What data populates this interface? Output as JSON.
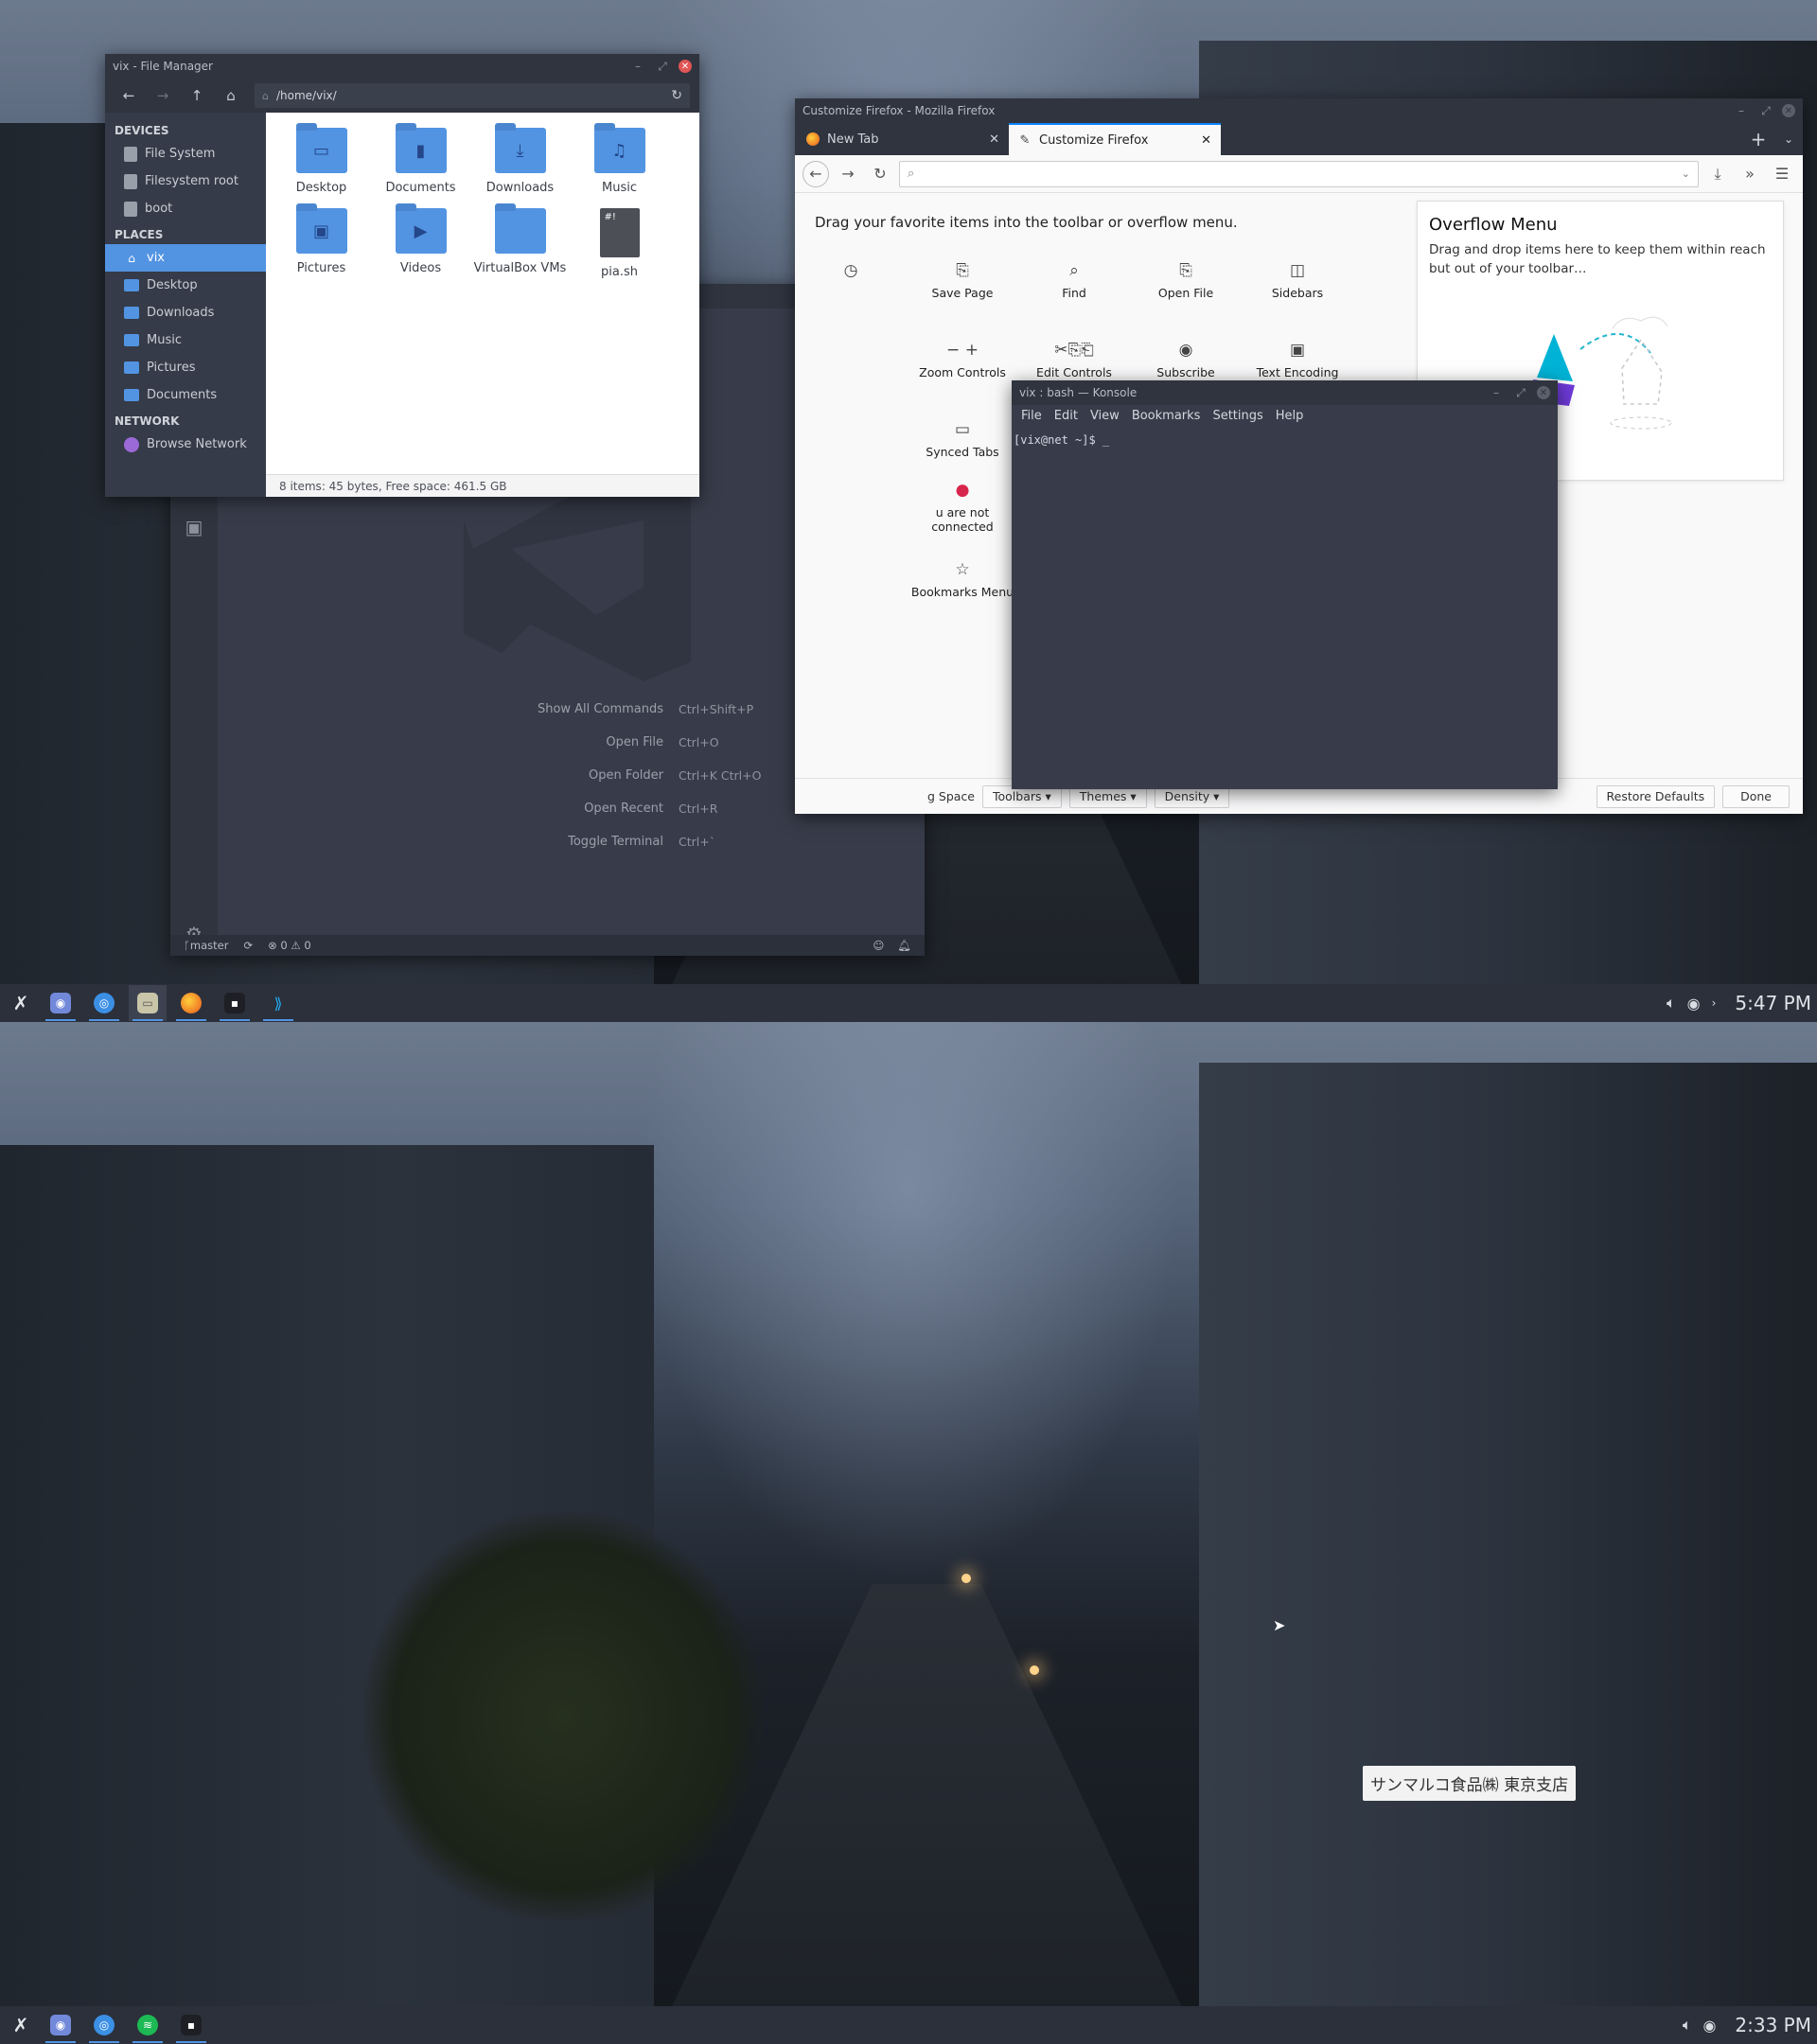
{
  "file_manager": {
    "title": "vix - File Manager",
    "path": "/home/vix/",
    "sections": {
      "devices": "DEVICES",
      "places": "PLACES",
      "network": "NETWORK"
    },
    "devices": [
      "File System",
      "Filesystem root",
      "boot"
    ],
    "places": [
      "vix",
      "Desktop",
      "Downloads",
      "Music",
      "Pictures",
      "Documents"
    ],
    "network": [
      "Browse Network"
    ],
    "files": [
      {
        "name": "Desktop",
        "icon": "desktop-folder-icon",
        "glyph": "▭"
      },
      {
        "name": "Documents",
        "icon": "documents-folder-icon",
        "glyph": "▮"
      },
      {
        "name": "Downloads",
        "icon": "downloads-folder-icon",
        "glyph": "⤓"
      },
      {
        "name": "Music",
        "icon": "music-folder-icon",
        "glyph": "♫"
      },
      {
        "name": "Pictures",
        "icon": "pictures-folder-icon",
        "glyph": "▣"
      },
      {
        "name": "Videos",
        "icon": "videos-folder-icon",
        "glyph": "▶"
      },
      {
        "name": "VirtualBox VMs",
        "icon": "folder-icon",
        "glyph": ""
      },
      {
        "name": "pia.sh",
        "icon": "script-file-icon",
        "glyph": "#!"
      }
    ],
    "status": "8 items: 45 bytes, Free space: 461.5 GB",
    "accent": "#5294e2"
  },
  "vscode": {
    "shortcuts": [
      {
        "label": "Show All Commands",
        "keys": "Ctrl+Shift+P"
      },
      {
        "label": "Open File",
        "keys": "Ctrl+O"
      },
      {
        "label": "Open Folder",
        "keys": "Ctrl+K Ctrl+O"
      },
      {
        "label": "Open Recent",
        "keys": "Ctrl+R"
      },
      {
        "label": "Toggle Terminal",
        "keys": "Ctrl+`"
      }
    ],
    "status": {
      "branch": "master",
      "errors": "0",
      "warnings": "0"
    }
  },
  "firefox": {
    "title": "Customize Firefox - Mozilla Firefox",
    "tabs": [
      "New Tab",
      "Customize Firefox"
    ],
    "hint": "Drag your favorite items into the toolbar or overflow menu.",
    "items": [
      {
        "label": "",
        "glyph": "◷"
      },
      {
        "label": "Save Page",
        "glyph": "⎘"
      },
      {
        "label": "Find",
        "glyph": "⌕"
      },
      {
        "label": "Open File",
        "glyph": "⎘"
      },
      {
        "label": "Sidebars",
        "glyph": "◫"
      },
      {
        "label": "Zoom Controls",
        "glyph": "− +"
      },
      {
        "label": "Edit Controls",
        "glyph": "✂⎘⎗"
      },
      {
        "label": "Subscribe",
        "glyph": "◉"
      },
      {
        "label": "Text Encoding",
        "glyph": "▣"
      },
      {
        "label": "Synced Tabs",
        "glyph": "▭"
      },
      {
        "label": "u are not connected",
        "glyph": "●"
      },
      {
        "label": "Bookmarks Menu",
        "glyph": "☆"
      }
    ],
    "overflow": {
      "title": "Overflow Menu",
      "text": "Drag and drop items here to keep them within reach but out of your toolbar…"
    },
    "bottom": {
      "space": "g Space",
      "toolbars": "Toolbars ▾",
      "themes": "Themes ▾",
      "density": "Density ▾",
      "restore": "Restore Defaults",
      "done": "Done"
    }
  },
  "konsole": {
    "title": "vix : bash — Konsole",
    "menu": [
      "File",
      "Edit",
      "View",
      "Bookmarks",
      "Settings",
      "Help"
    ],
    "prompt": "[vix@net ~]$ _"
  },
  "taskbar_top": {
    "clock": "5:47 PM"
  },
  "taskbar_bottom": {
    "clock": "2:33 PM"
  },
  "wallpaper": {
    "sign": "サンマルコ食品㈱ 東京支店"
  }
}
